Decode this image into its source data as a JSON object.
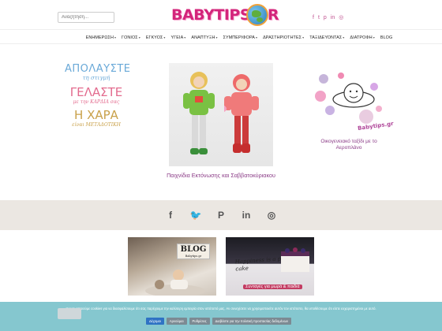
{
  "header": {
    "search_placeholder": "Αναζήτηση...",
    "logo_text": "BABYTIPS.GR",
    "social_icons": [
      "facebook-icon",
      "twitter-icon",
      "pinterest-icon",
      "linkedin-icon",
      "instagram-icon"
    ]
  },
  "nav": {
    "items": [
      {
        "label": "ΕΝΗΜΕΡΩΣΗ",
        "has_dropdown": true
      },
      {
        "label": "ΓΟΝΙΟΣ",
        "has_dropdown": true
      },
      {
        "label": "ΕΓΚΥΟΣ",
        "has_dropdown": true
      },
      {
        "label": "ΥΓΕΙΑ",
        "has_dropdown": true
      },
      {
        "label": "ΑΝΑΠΤΥΞΗ",
        "has_dropdown": true
      },
      {
        "label": "ΣΥΜΠΕΡΙΦΟΡΑ",
        "has_dropdown": true
      },
      {
        "label": "ΔΡΑΣΤΗΡΙΟΤΗΤΕΣ",
        "has_dropdown": true
      },
      {
        "label": "ΤΑΞΙΔΕΥΟΝΤΑΣ",
        "has_dropdown": true
      },
      {
        "label": "ΔΙΑΤΡΟΦΗ",
        "has_dropdown": true
      },
      {
        "label": "BLOG",
        "has_dropdown": false
      }
    ],
    "chevron": "▾"
  },
  "quote": {
    "line1": "ΑΠΟΛΑΥΣΤΕ",
    "line1_sub": "τη στιγμή",
    "line2": "ΓΕΛΑΣΤΕ",
    "line2_sub": "με την ΚΑΡΔΙΑ σας",
    "line3": "Η ΧΑΡΑ",
    "line3_sub": "είναι ΜΕΤΑΔΟΤΙΚΗ"
  },
  "feature": {
    "caption": "Παιχνίδια Εκτόνωσης και Σαββατοκύριακου"
  },
  "travel": {
    "logo_text": "Babytips.gr",
    "caption": "Οικογενειακό ταξίδι με το Αεροπλάνο"
  },
  "band": {
    "icons": [
      {
        "name": "facebook-icon",
        "glyph": "f"
      },
      {
        "name": "twitter-icon",
        "glyph": "🐦"
      },
      {
        "name": "pinterest-icon",
        "glyph": "P"
      },
      {
        "name": "linkedin-icon",
        "glyph": "in"
      },
      {
        "name": "instagram-icon",
        "glyph": "◎"
      }
    ]
  },
  "tiles": {
    "blog_sign": "BLOG",
    "blog_sign_sub": "Babytips.gr",
    "tile2_text": "Happiness is a piece of cake",
    "tile2_caption": "Συνταγές για μωρά & παιδιά"
  },
  "cookie": {
    "text": "Χρησιμοποιούμε cookies για να διασφαλίσουμε ότι σας παρέχουμε την καλύτερη εμπειρία στον ιστότοπό μας. Αν συνεχίσετε να χρησιμοποιείτε αυτόν τον ιστότοπο, θα υποθέσουμε ότι είστε ευχαριστημένοι με αυτό.",
    "buttons": [
      "Δέχομαι",
      "Αρνούμαι",
      "Ρυθμίσεις",
      "Διαβάστε για την πολιτική προστασίας δεδομένων"
    ]
  },
  "colors": {
    "brand": "#d3257b",
    "accent_purple": "#8a3a86",
    "band_bg": "#ebe7e2",
    "cookie_bg": "#85c7cf",
    "accept_btn": "#2f73c4"
  }
}
